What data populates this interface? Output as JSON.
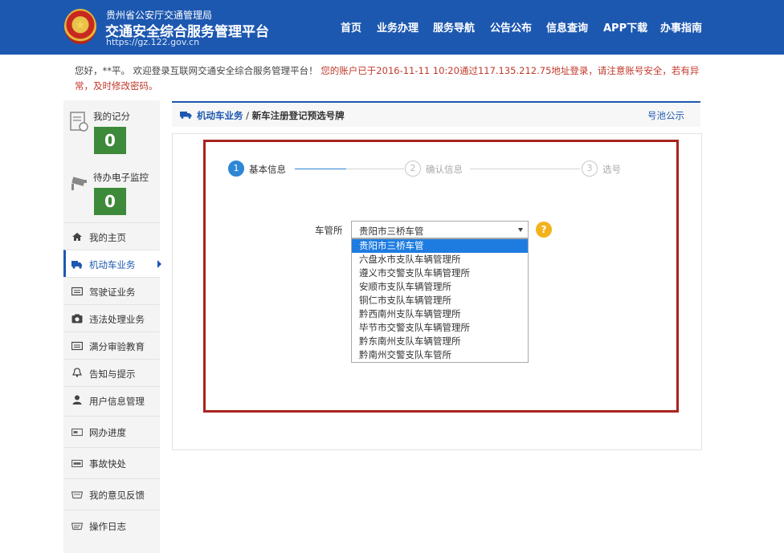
{
  "header": {
    "org": "贵州省公安厅交通管理局",
    "title": "交通安全综合服务管理平台",
    "url": "https://gz.122.gov.cn",
    "nav": [
      "首页",
      "业务办理",
      "服务导航",
      "公告公布",
      "信息查询",
      "APP下载",
      "办事指南"
    ]
  },
  "welcome": {
    "greeting": "您好，**平。 欢迎登录互联网交通安全综合服务管理平台！",
    "warning": "您的账户已于2016-11-11 10:20通过117.135.212.75地址登录，请注意账号安全，若有异常，及时修改密码。"
  },
  "sidebar": {
    "score_label": "我的记分",
    "score_value": "0",
    "pending_label": "待办电子监控",
    "pending_value": "0",
    "items": [
      {
        "label": "我的主页",
        "icon": "home-icon"
      },
      {
        "label": "机动车业务",
        "icon": "truck-icon"
      },
      {
        "label": "驾驶证业务",
        "icon": "card-icon"
      },
      {
        "label": "违法处理业务",
        "icon": "camera-icon"
      },
      {
        "label": "满分审验教育",
        "icon": "card-icon"
      },
      {
        "label": "告知与提示",
        "icon": "bell-icon"
      },
      {
        "label": "用户信息管理",
        "icon": "user-icon"
      },
      {
        "label": "网办进度",
        "icon": "progress-icon"
      },
      {
        "label": "事故快处",
        "icon": "accident-icon"
      },
      {
        "label": "我的意见反馈",
        "icon": "feedback-icon"
      },
      {
        "label": "操作日志",
        "icon": "log-icon"
      }
    ],
    "active_index": 1
  },
  "breadcrumb": {
    "section": "机动车业务",
    "sep": " / ",
    "page": "新车注册登记预选号牌",
    "pool_link": "号池公示"
  },
  "steps": [
    {
      "num": "1",
      "label": "基本信息",
      "active": true
    },
    {
      "num": "2",
      "label": "确认信息",
      "active": false
    },
    {
      "num": "3",
      "label": "选号",
      "active": false
    }
  ],
  "form": {
    "field_label": "车管所",
    "selected": "贵阳市三桥车管",
    "help": "?",
    "options": [
      "贵阳市三桥车管",
      "六盘水市支队车辆管理所",
      "遵义市交警支队车辆管理所",
      "安顺市支队车辆管理所",
      "铜仁市支队车辆管理所",
      "黔西南州支队车辆管理所",
      "毕节市交警支队车辆管理所",
      "黔东南州支队车辆管理所",
      "黔南州交警支队车管所"
    ]
  },
  "colors": {
    "brand": "#1d58b0",
    "score_box": "#3d8a3a",
    "step_active": "#2e86d6",
    "option_selected": "#1e7ce0",
    "highlight_box": "#a8231e",
    "warning_text": "#c0392b"
  }
}
